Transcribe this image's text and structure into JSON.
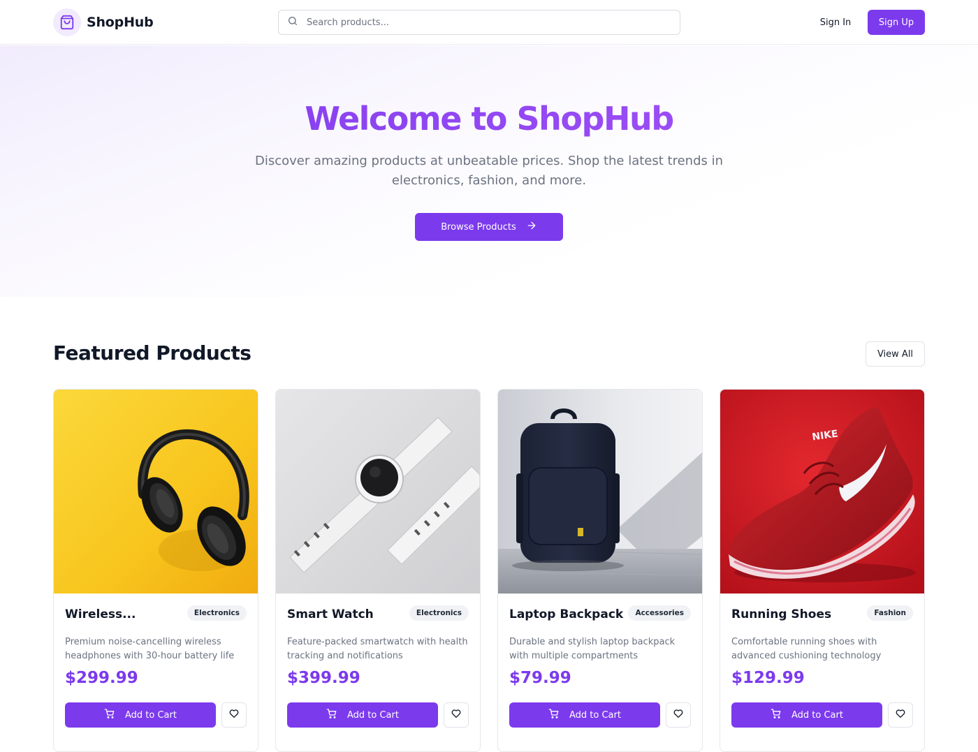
{
  "header": {
    "brand": "ShopHub",
    "search_placeholder": "Search products...",
    "sign_in": "Sign In",
    "sign_up": "Sign Up"
  },
  "hero": {
    "title": "Welcome to ShopHub",
    "subtitle": "Discover amazing products at unbeatable prices. Shop the latest trends in electronics, fashion, and more.",
    "cta": "Browse Products"
  },
  "featured": {
    "title": "Featured Products",
    "view_all": "View All",
    "add_to_cart": "Add to Cart",
    "products": [
      {
        "name": "Wireless...",
        "category": "Electronics",
        "description": "Premium noise-cancelling wireless headphones with 30-hour battery life",
        "price": "$299.99"
      },
      {
        "name": "Smart Watch",
        "category": "Electronics",
        "description": "Feature-packed smartwatch with health tracking and notifications",
        "price": "$399.99"
      },
      {
        "name": "Laptop Backpack",
        "category": "Accessories",
        "description": "Durable and stylish laptop backpack with multiple compartments",
        "price": "$79.99"
      },
      {
        "name": "Running Shoes",
        "category": "Fashion",
        "description": "Comfortable running shoes with advanced cushioning technology",
        "price": "$129.99"
      }
    ]
  },
  "colors": {
    "accent": "#7c3aed",
    "muted_text": "#6b7280"
  }
}
